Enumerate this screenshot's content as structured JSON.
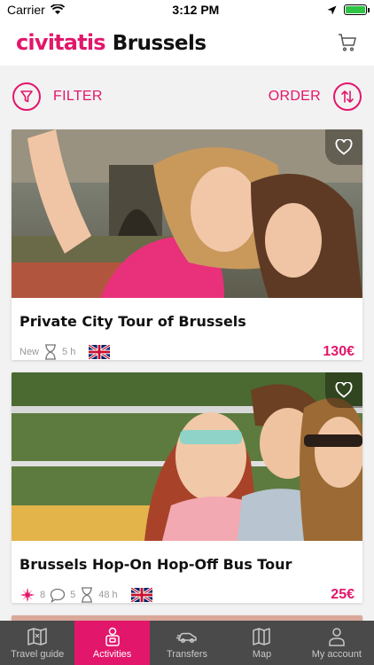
{
  "status": {
    "carrier": "Carrier",
    "time": "3:12 PM"
  },
  "header": {
    "logo": "civitatis",
    "city": "Brussels"
  },
  "toolbar": {
    "filter_label": "FILTER",
    "order_label": "ORDER"
  },
  "cards": [
    {
      "title": "Private City Tour of Brussels",
      "new_label": "New",
      "duration": "5 h",
      "price": "130€"
    },
    {
      "title": "Brussels Hop-On Hop-Off Bus Tour",
      "rating": "8",
      "comments": "5",
      "duration": "48 h",
      "price": "25€"
    }
  ],
  "tabs": [
    {
      "label": "Travel guide",
      "icon": "map-book-icon"
    },
    {
      "label": "Activities",
      "icon": "activities-icon",
      "active": true
    },
    {
      "label": "Transfers",
      "icon": "car-icon"
    },
    {
      "label": "Map",
      "icon": "map-icon"
    },
    {
      "label": "My account",
      "icon": "user-icon"
    }
  ],
  "colors": {
    "accent": "#e2166b",
    "tabbar": "#4a4a4a"
  }
}
